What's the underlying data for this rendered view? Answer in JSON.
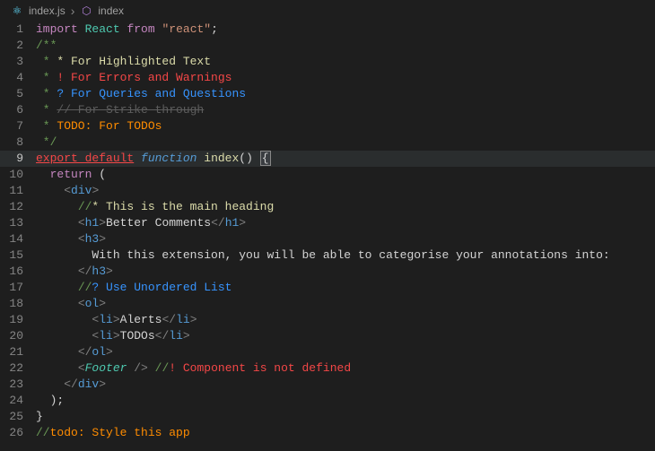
{
  "breadcrumb": {
    "file": "index.js",
    "symbol": "index"
  },
  "icons": {
    "react": "⚛",
    "cube": "⬡"
  },
  "current_line": 9,
  "lines": [
    {
      "n": 1,
      "html": "<span class='kw-import'>import</span> <span class='kw-var'>React</span> <span class='kw-from'>from</span> <span class='str'>\"react\"</span>;"
    },
    {
      "n": 2,
      "html": "<span class='comment'>/**</span>"
    },
    {
      "n": 3,
      "html": "<span class='comment'> * </span><span class='hl-star'>* For Highlighted Text</span>"
    },
    {
      "n": 4,
      "html": "<span class='comment'> * </span><span class='hl-err'>! For Errors and Warnings</span>"
    },
    {
      "n": 5,
      "html": "<span class='comment'> * </span><span class='hl-q'>? For Queries and Questions</span>"
    },
    {
      "n": 6,
      "html": "<span class='comment'> * </span><span class='strike'>// For Strike-through</span>"
    },
    {
      "n": 7,
      "html": "<span class='comment'> * </span><span class='todo'>TODO: For TODOs</span>"
    },
    {
      "n": 8,
      "html": "<span class='comment'> */</span>"
    },
    {
      "n": 9,
      "html": "<span class='kw-export'>export default</span> <span class='kw-func'>function</span> <span class='fn-name'>index</span><span class='brkt'>()</span> <span class='brace-hl'>{</span>"
    },
    {
      "n": 10,
      "html": "  <span class='kw-return'>return</span> <span class='brkt'>(</span>"
    },
    {
      "n": 11,
      "html": "    <span class='tag-angle'>&lt;</span><span class='tag-name'>div</span><span class='tag-angle'>&gt;</span>"
    },
    {
      "n": 12,
      "html": "      <span class='jsx-comment'>//</span><span class='jsx-hlstar'>* This is the main heading</span>"
    },
    {
      "n": 13,
      "html": "      <span class='tag-angle'>&lt;</span><span class='tag-name'>h1</span><span class='tag-angle'>&gt;</span>Better Comments<span class='tag-angle'>&lt;/</span><span class='tag-name'>h1</span><span class='tag-angle'>&gt;</span>"
    },
    {
      "n": 14,
      "html": "      <span class='tag-angle'>&lt;</span><span class='tag-name'>h3</span><span class='tag-angle'>&gt;</span>"
    },
    {
      "n": 15,
      "html": "        With this extension, you will be able to categorise your annotations into:"
    },
    {
      "n": 16,
      "html": "      <span class='tag-angle'>&lt;/</span><span class='tag-name'>h3</span><span class='tag-angle'>&gt;</span>"
    },
    {
      "n": 17,
      "html": "      <span class='jsx-comment'>//</span><span class='jsx-q'>? Use Unordered List</span>"
    },
    {
      "n": 18,
      "html": "      <span class='tag-angle'>&lt;</span><span class='tag-name'>ol</span><span class='tag-angle'>&gt;</span>"
    },
    {
      "n": 19,
      "html": "        <span class='tag-angle'>&lt;</span><span class='tag-name'>li</span><span class='tag-angle'>&gt;</span>Alerts<span class='tag-angle'>&lt;/</span><span class='tag-name'>li</span><span class='tag-angle'>&gt;</span>"
    },
    {
      "n": 20,
      "html": "        <span class='tag-angle'>&lt;</span><span class='tag-name'>li</span><span class='tag-angle'>&gt;</span>TODOs<span class='tag-angle'>&lt;/</span><span class='tag-name'>li</span><span class='tag-angle'>&gt;</span>"
    },
    {
      "n": 21,
      "html": "      <span class='tag-angle'>&lt;/</span><span class='tag-name'>ol</span><span class='tag-angle'>&gt;</span>"
    },
    {
      "n": 22,
      "html": "      <span class='tag-angle'>&lt;</span><span class='component'>Footer</span> <span class='tag-angle'>/&gt;</span> <span class='jsx-comment'>//</span><span class='jsx-err'>! Component is not defined</span>"
    },
    {
      "n": 23,
      "html": "    <span class='tag-angle'>&lt;/</span><span class='tag-name'>div</span><span class='tag-angle'>&gt;</span>"
    },
    {
      "n": 24,
      "html": "  <span class='brkt'>)</span>;"
    },
    {
      "n": 25,
      "html": "<span class='brkt'>}</span>"
    },
    {
      "n": 26,
      "html": "<span class='jsx-comment'>//</span><span class='todo-lower'>todo: Style this app</span>"
    }
  ]
}
